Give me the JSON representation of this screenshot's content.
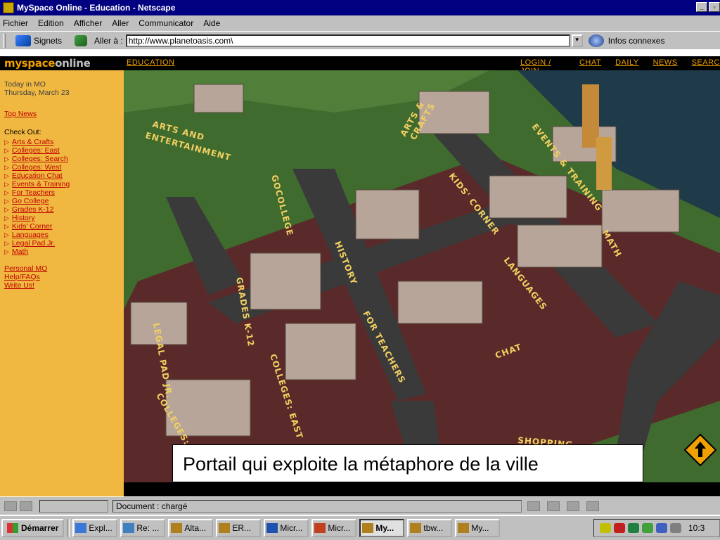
{
  "window": {
    "title": "MySpace Online - Education - Netscape"
  },
  "menu": {
    "items": [
      "Fichier",
      "Edition",
      "Afficher",
      "Aller",
      "Communicator",
      "Aide"
    ]
  },
  "locationbar": {
    "bookmarks_label": "Signets",
    "goto_label": "Aller à :",
    "url": "http://www.planetoasis.com\\",
    "related_label": "Infos connexes"
  },
  "site": {
    "logo_part1": "myspace",
    "logo_part2": "online",
    "nav_left": "EDUCATION",
    "nav_right": [
      "LOGIN / JOIN",
      "CHAT",
      "DAILY",
      "NEWS",
      "SEARC"
    ]
  },
  "sidebar": {
    "today_title": "Today in MO",
    "today_date": "Thursday, March 23",
    "top_news": "Top News",
    "check_out": "Check Out:",
    "links": [
      "Arts & Crafts",
      "Colleges: East",
      "Colleges: Search",
      "Colleges: West",
      "Education Chat",
      "Events & Training",
      "For Teachers",
      "Go College",
      "Grades K-12",
      "History",
      "Kids' Corner",
      "Languages",
      "Legal Pad Jr.",
      "Math"
    ],
    "footer_links": [
      "Personal MO",
      "Help/FAQs",
      "Write Us!"
    ]
  },
  "map": {
    "labels": {
      "arts_ent": [
        "ARTS AND",
        "ENTERTAINMENT"
      ],
      "arts_crafts": [
        "ARTS &",
        "CRAFTS"
      ],
      "gocollege": "GOCOLLEGE",
      "kids": "KIDS' CORNER",
      "events": "EVENTS & TRAINING",
      "history": "HISTORY",
      "languages": "LANGUAGES",
      "math": "MATH",
      "grades": "GRADES K-12",
      "teachers": "FOR TEACHERS",
      "chat": "CHAT",
      "legalpad": "LEGAL PAD JR.",
      "coll_east": "COLLEGES: EAST",
      "coll_west": "COLLEGES:",
      "shopping": "SHOPPING"
    },
    "colors": {
      "grass": "#3f6b2e",
      "road": "#3a3a3a",
      "block": "#6b2f2f",
      "label": "#f2d060"
    }
  },
  "caption": "Portail qui exploite la métaphore de la ville",
  "status": {
    "text": "Document : chargé"
  },
  "taskbar": {
    "start_label": "Démarrer",
    "tasks": [
      {
        "label": "Expl...",
        "icon": "explorer-icon",
        "active": false
      },
      {
        "label": "Re: ...",
        "icon": "mail-icon",
        "active": false
      },
      {
        "label": "Alta...",
        "icon": "netscape-icon",
        "active": false
      },
      {
        "label": "ER...",
        "icon": "netscape-icon",
        "active": false
      },
      {
        "label": "Micr...",
        "icon": "word-icon",
        "active": false
      },
      {
        "label": "Micr...",
        "icon": "powerpoint-icon",
        "active": false
      },
      {
        "label": "My...",
        "icon": "netscape-icon",
        "active": true
      },
      {
        "label": "tbw...",
        "icon": "netscape-icon",
        "active": false
      },
      {
        "label": "My...",
        "icon": "netscape-icon",
        "active": false
      }
    ],
    "clock": "10:3"
  }
}
